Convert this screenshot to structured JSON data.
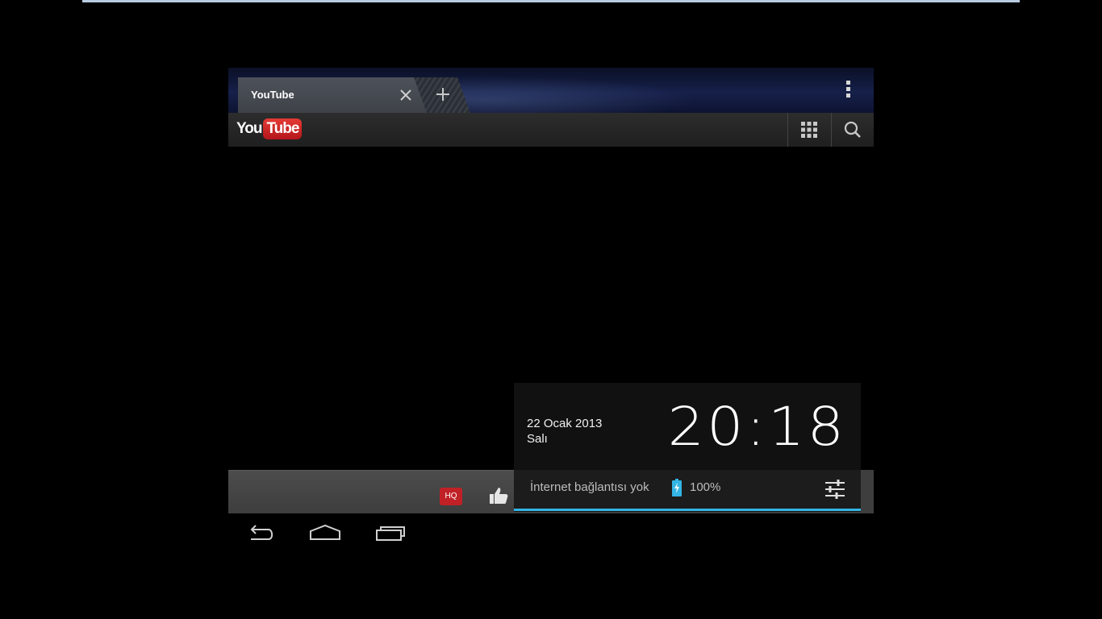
{
  "browser": {
    "tab_title": "YouTube",
    "logo_you": "You",
    "logo_tube": "Tube"
  },
  "player": {
    "hq_label": "HQ"
  },
  "notification": {
    "date": "22 Ocak 2013",
    "weekday": "Salı",
    "time": "20:18",
    "connection_status": "İnternet bağlantısı yok",
    "battery_percent": "100%"
  },
  "icons": {
    "tab_close": "close-icon",
    "new_tab": "plus-icon",
    "overflow": "overflow-menu-icon",
    "apps": "grid-icon",
    "search": "search-icon",
    "like": "thumbs-up-icon",
    "battery": "battery-charging-icon",
    "settings": "settings-sliders-icon",
    "back": "back-icon",
    "home": "home-icon",
    "recents": "recent-apps-icon"
  },
  "colors": {
    "accent": "#33b5e5",
    "youtube_red": "#c4302b",
    "battery": "#33b5e5"
  }
}
